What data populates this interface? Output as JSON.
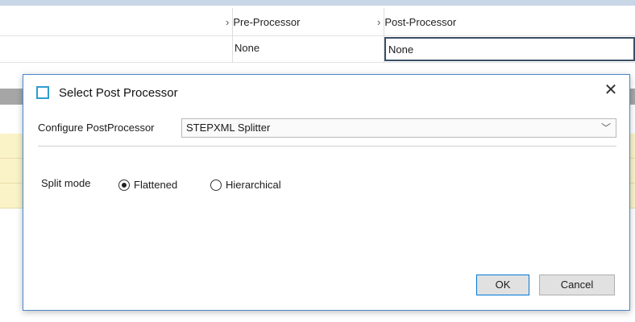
{
  "background": {
    "columns": {
      "pre_processor": {
        "header": "Pre-Processor",
        "value": "None"
      },
      "post_processor": {
        "header": "Post-Processor",
        "value": "None"
      }
    }
  },
  "dialog": {
    "title": "Select Post Processor",
    "close_glyph": "✕",
    "configure_label": "Configure PostProcessor",
    "configure_value": "STEPXML Splitter",
    "split_mode_label": "Split mode",
    "split_options": [
      {
        "label": "Flattened",
        "checked": true
      },
      {
        "label": "Hierarchical",
        "checked": false
      }
    ],
    "ok_label": "OK",
    "cancel_label": "Cancel"
  },
  "colors": {
    "accent": "#0078d7",
    "dialog_border": "#4a86c8",
    "icon": "#2f9ccf"
  },
  "icons": {
    "column_expand": "chevron-right-icon",
    "dropdown": "chevron-down-icon",
    "close": "close-icon",
    "app": "window-icon"
  }
}
